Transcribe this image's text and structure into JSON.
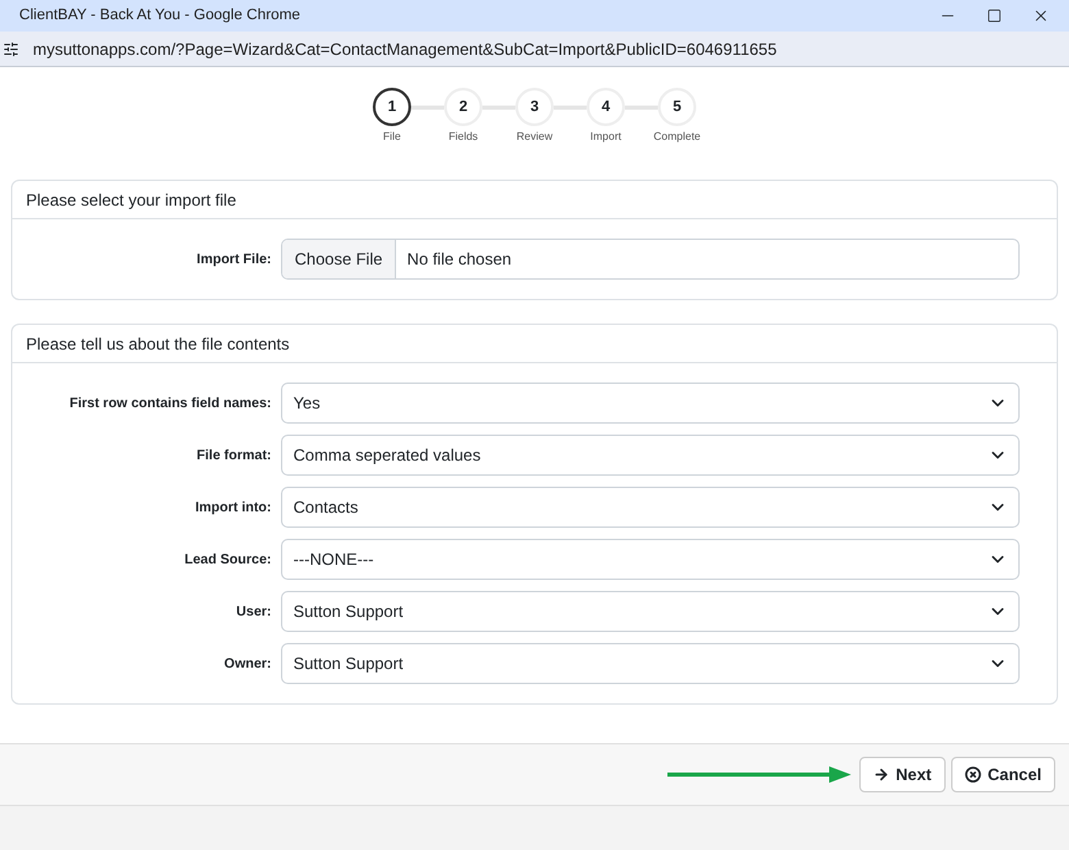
{
  "window": {
    "title": "ClientBAY - Back At You - Google Chrome"
  },
  "address_bar": {
    "url": "mysuttonapps.com/?Page=Wizard&Cat=ContactManagement&SubCat=Import&PublicID=6046911655"
  },
  "steps": [
    {
      "number": "1",
      "label": "File",
      "selected": true
    },
    {
      "number": "2",
      "label": "Fields",
      "selected": false
    },
    {
      "number": "3",
      "label": "Review",
      "selected": false
    },
    {
      "number": "4",
      "label": "Import",
      "selected": false
    },
    {
      "number": "5",
      "label": "Complete",
      "selected": false
    }
  ],
  "file_panel": {
    "title": "Please select your import file",
    "label": "Import File:",
    "button": "Choose File",
    "status": "No file chosen"
  },
  "contents_panel": {
    "title": "Please tell us about the file contents",
    "fields": [
      {
        "label": "First row contains field names:",
        "value": "Yes"
      },
      {
        "label": "File format:",
        "value": "Comma seperated values"
      },
      {
        "label": "Import into:",
        "value": "Contacts"
      },
      {
        "label": "Lead Source:",
        "value": "---NONE---"
      },
      {
        "label": "User:",
        "value": "Sutton Support"
      },
      {
        "label": "Owner:",
        "value": "Sutton Support"
      }
    ]
  },
  "footer": {
    "buttons": [
      {
        "kind": "next",
        "label": "Next"
      },
      {
        "kind": "cancel",
        "label": "Cancel"
      }
    ]
  }
}
